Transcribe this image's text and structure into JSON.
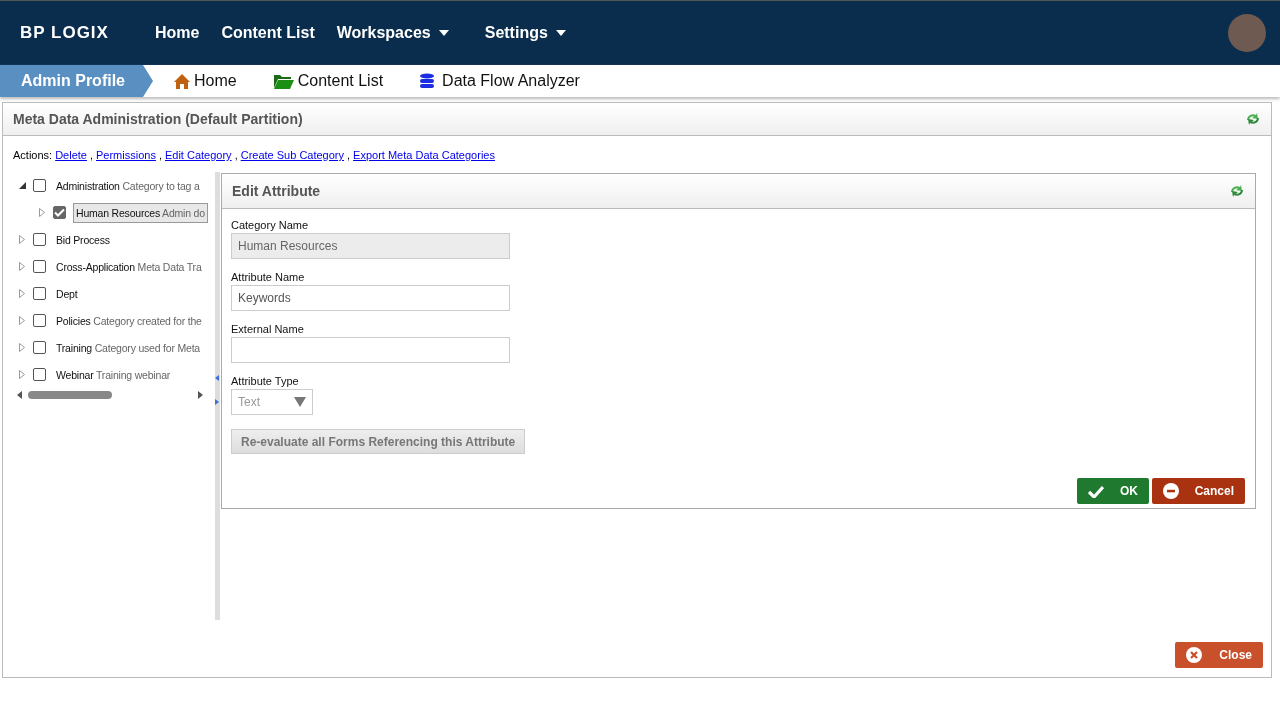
{
  "top_nav": {
    "logo": "BP LOGIX",
    "items": [
      {
        "label": "Home",
        "dropdown": false
      },
      {
        "label": "Content List",
        "dropdown": false
      },
      {
        "label": "Workspaces",
        "dropdown": true
      },
      {
        "label": "Settings",
        "dropdown": true
      }
    ]
  },
  "breadcrumb": {
    "profile": "Admin Profile",
    "links": [
      {
        "label": "Home",
        "kind": "home"
      },
      {
        "label": "Content List",
        "kind": "folder"
      },
      {
        "label": "Data Flow Analyzer",
        "kind": "database"
      }
    ]
  },
  "panel": {
    "title": "Meta Data Administration (Default Partition)",
    "actions_label": "Actions:",
    "actions_separator": ",",
    "actions": [
      "Delete",
      "Permissions",
      "Edit Category",
      "Create Sub Category",
      "Export Meta Data Categories"
    ],
    "tree": [
      {
        "name": "Administration",
        "description": "Category to tag a",
        "expanded": true,
        "checked": false,
        "selected": false,
        "children": [
          {
            "name": "Human Resources",
            "description": "Admin do",
            "expanded": false,
            "checked": true,
            "selected": true
          }
        ]
      },
      {
        "name": "Bid Process",
        "expanded": false,
        "checked": false,
        "selected": false
      },
      {
        "name": "Cross-Application",
        "description": "Meta Data Tra",
        "expanded": false,
        "checked": false,
        "selected": false
      },
      {
        "name": "Dept",
        "expanded": false,
        "checked": false,
        "selected": false
      },
      {
        "name": "Policies",
        "description": "Category created for the",
        "expanded": false,
        "checked": false,
        "selected": false
      },
      {
        "name": "Training",
        "description": "Category used for Meta",
        "expanded": false,
        "checked": false,
        "selected": false
      },
      {
        "name": "Webinar",
        "description": "Training webinar",
        "expanded": false,
        "checked": false,
        "selected": false
      }
    ],
    "edit": {
      "title": "Edit Attribute",
      "fields": [
        {
          "label": "Category Name",
          "value": "Human Resources",
          "disabled": true
        },
        {
          "label": "Attribute Name",
          "value": "Keywords",
          "disabled": false
        },
        {
          "label": "External Name",
          "disabled": false
        }
      ],
      "type_label": "Attribute Type",
      "type_value": "Text",
      "reevaluate": "Re-evaluate all Forms Referencing this Attribute",
      "ok": "OK",
      "cancel": "Cancel"
    },
    "close": "Close"
  }
}
